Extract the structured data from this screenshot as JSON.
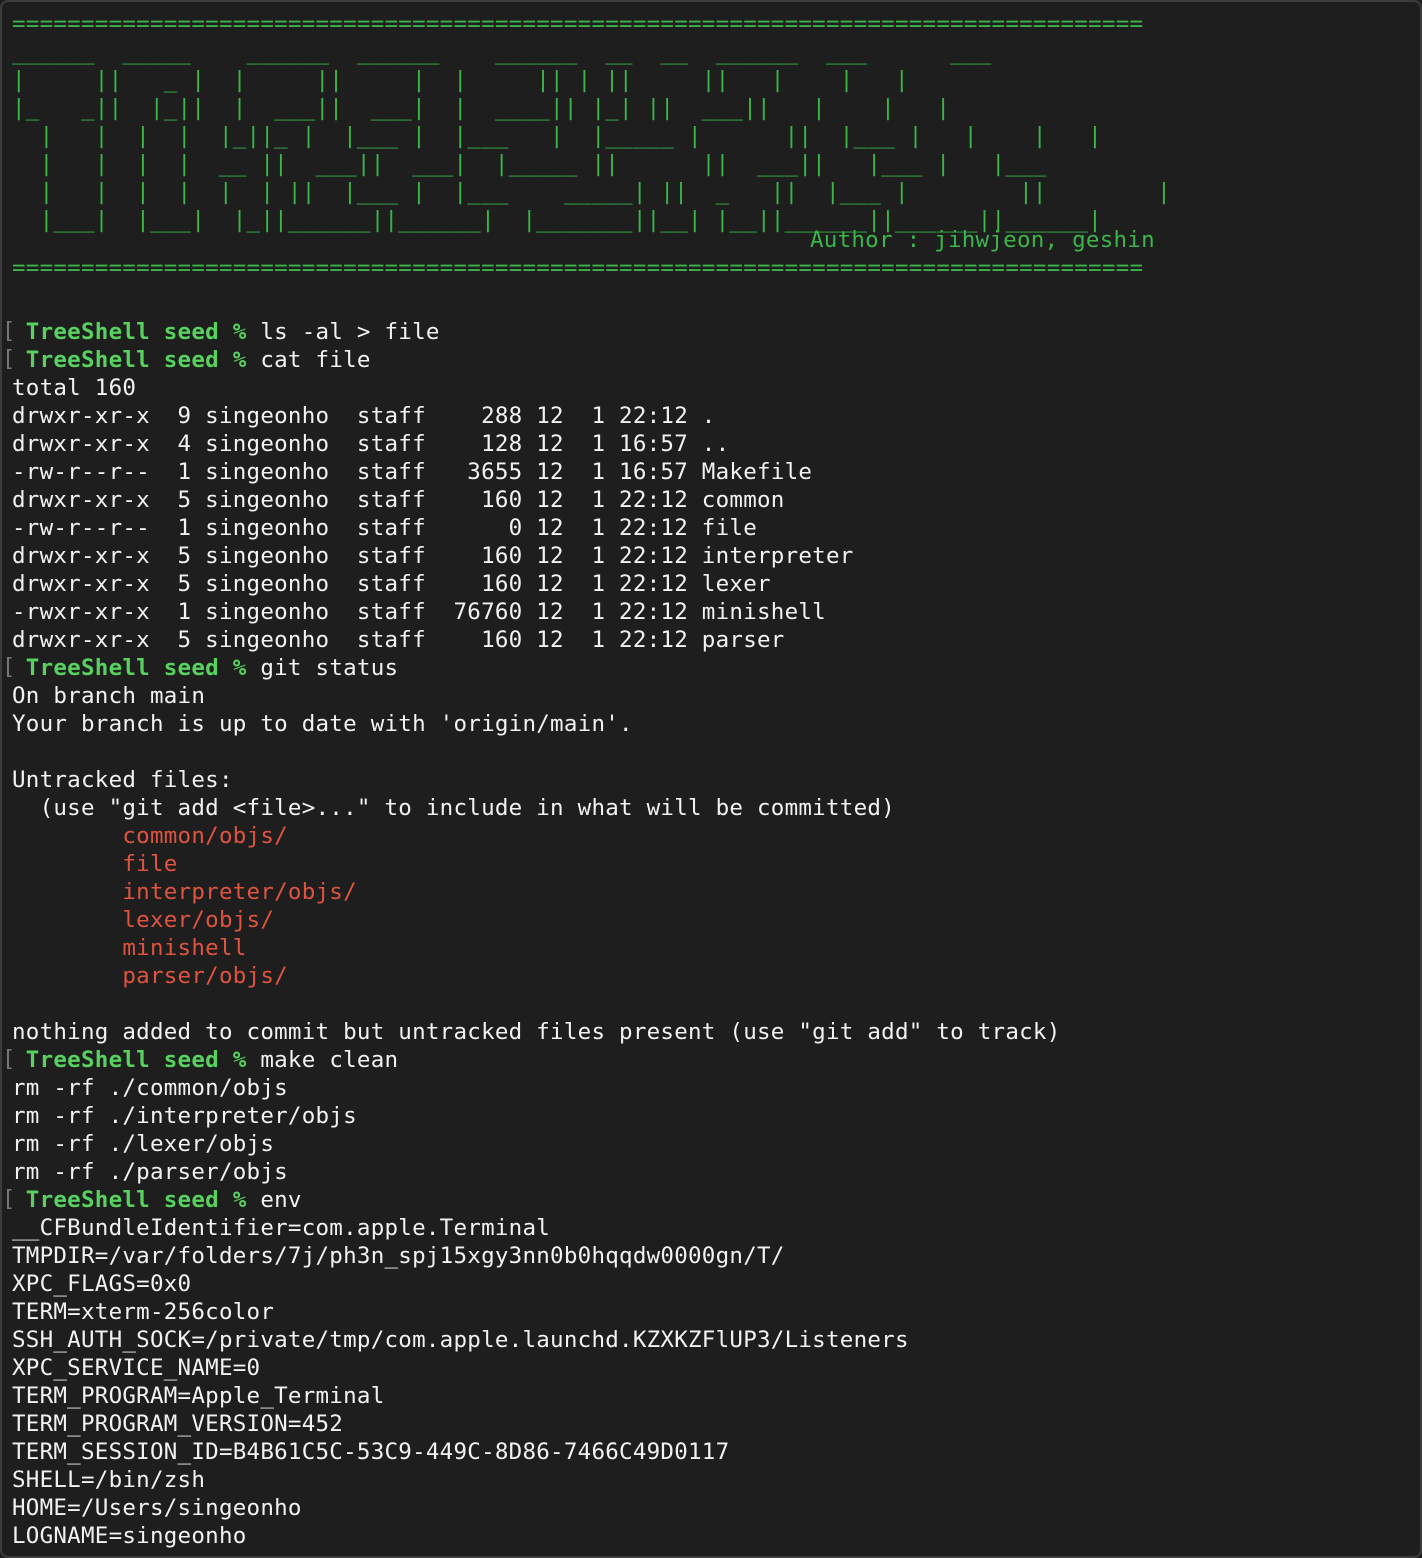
{
  "banner": {
    "rule": "==================================================================================",
    "art": [
      "______  _____    ______  ______    ______  __  __  ______  ___      ___  ",
      "|     ||   _ |  |     ||     |  |     || | ||     ||   |    |   |",
      "|_   _||  |_||  |  ___||  ___|  |  ____|| |_| ||  ___||   |    |   |",
      "  |   |  |  |  |_||_ |  |___ |  |___   |  |_____ |      ||  |___ |   |    |   |",
      "  |   |  |  |  __ ||  ___||  ___|  |_____ ||      ||  ___||   |___ |   |___",
      "  |   |  |  |  |  | ||  |___ |  |___    _____| ||  _   ||  |___ |        ||        |",
      "  |___|  |___|  |_||______||______|  |_______||__| |__||______||______||______|"
    ],
    "author": "Author : jihwjeon, geshin"
  },
  "prompt": "TreeShell seed %",
  "blocks": [
    {
      "type": "cmd",
      "text": "ls -al > file"
    },
    {
      "type": "cmd",
      "text": "cat file"
    },
    {
      "type": "out",
      "text": "total 160"
    },
    {
      "type": "out",
      "text": "drwxr-xr-x  9 singeonho  staff    288 12  1 22:12 ."
    },
    {
      "type": "out",
      "text": "drwxr-xr-x  4 singeonho  staff    128 12  1 16:57 .."
    },
    {
      "type": "out",
      "text": "-rw-r--r--  1 singeonho  staff   3655 12  1 16:57 Makefile"
    },
    {
      "type": "out",
      "text": "drwxr-xr-x  5 singeonho  staff    160 12  1 22:12 common"
    },
    {
      "type": "out",
      "text": "-rw-r--r--  1 singeonho  staff      0 12  1 22:12 file"
    },
    {
      "type": "out",
      "text": "drwxr-xr-x  5 singeonho  staff    160 12  1 22:12 interpreter"
    },
    {
      "type": "out",
      "text": "drwxr-xr-x  5 singeonho  staff    160 12  1 22:12 lexer"
    },
    {
      "type": "out",
      "text": "-rwxr-xr-x  1 singeonho  staff  76760 12  1 22:12 minishell"
    },
    {
      "type": "out",
      "text": "drwxr-xr-x  5 singeonho  staff    160 12  1 22:12 parser"
    },
    {
      "type": "cmd",
      "text": "git status"
    },
    {
      "type": "out",
      "text": "On branch main"
    },
    {
      "type": "out",
      "text": "Your branch is up to date with 'origin/main'."
    },
    {
      "type": "out",
      "text": ""
    },
    {
      "type": "out",
      "text": "Untracked files:"
    },
    {
      "type": "out",
      "text": "  (use \"git add <file>...\" to include in what will be committed)"
    },
    {
      "type": "red",
      "text": "        common/objs/"
    },
    {
      "type": "red",
      "text": "        file"
    },
    {
      "type": "red",
      "text": "        interpreter/objs/"
    },
    {
      "type": "red",
      "text": "        lexer/objs/"
    },
    {
      "type": "red",
      "text": "        minishell"
    },
    {
      "type": "red",
      "text": "        parser/objs/"
    },
    {
      "type": "out",
      "text": ""
    },
    {
      "type": "out",
      "text": "nothing added to commit but untracked files present (use \"git add\" to track)"
    },
    {
      "type": "cmd",
      "text": "make clean"
    },
    {
      "type": "out",
      "text": "rm -rf ./common/objs"
    },
    {
      "type": "out",
      "text": "rm -rf ./interpreter/objs"
    },
    {
      "type": "out",
      "text": "rm -rf ./lexer/objs"
    },
    {
      "type": "out",
      "text": "rm -rf ./parser/objs"
    },
    {
      "type": "cmd",
      "text": "env"
    },
    {
      "type": "out",
      "text": "__CFBundleIdentifier=com.apple.Terminal"
    },
    {
      "type": "out",
      "text": "TMPDIR=/var/folders/7j/ph3n_spj15xgy3nn0b0hqqdw0000gn/T/"
    },
    {
      "type": "out",
      "text": "XPC_FLAGS=0x0"
    },
    {
      "type": "out",
      "text": "TERM=xterm-256color"
    },
    {
      "type": "out",
      "text": "SSH_AUTH_SOCK=/private/tmp/com.apple.launchd.KZXKZFlUP3/Listeners"
    },
    {
      "type": "out",
      "text": "XPC_SERVICE_NAME=0"
    },
    {
      "type": "out",
      "text": "TERM_PROGRAM=Apple_Terminal"
    },
    {
      "type": "out",
      "text": "TERM_PROGRAM_VERSION=452"
    },
    {
      "type": "out",
      "text": "TERM_SESSION_ID=B4B61C5C-53C9-449C-8D86-7466C49D0117"
    },
    {
      "type": "out",
      "text": "SHELL=/bin/zsh"
    },
    {
      "type": "out",
      "text": "HOME=/Users/singeonho"
    },
    {
      "type": "out",
      "text": "LOGNAME=singeonho"
    }
  ],
  "colors": {
    "background": "#1e1e1e",
    "banner": "#3bb54a",
    "prompt": "#57d25f",
    "untracked": "#e0533f",
    "text": "#f2f2f2"
  }
}
